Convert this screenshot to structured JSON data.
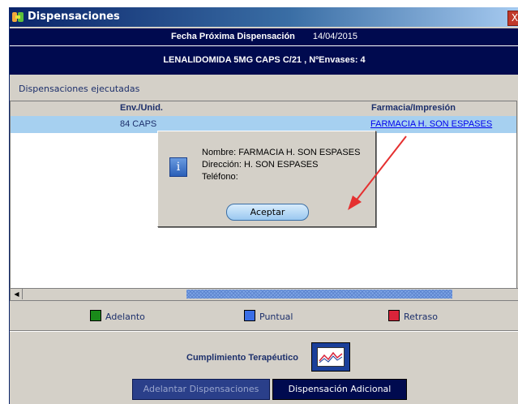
{
  "window": {
    "title": "Dispensaciones",
    "close_label": "X"
  },
  "header": {
    "fecha_label": "Fecha Próxima Dispensación",
    "fecha_value": "14/04/2015",
    "medication": "LENALIDOMIDA 5MG CAPS C/21  , NºEnvases: 4"
  },
  "section": {
    "title": "Dispensaciones ejecutadas"
  },
  "table": {
    "columns": [
      "Env./Unid.",
      "Farmacia/Impresión"
    ],
    "rows": [
      {
        "env_unid": "84 CAPS",
        "farmacia": "FARMACIA H. SON ESPASES"
      }
    ]
  },
  "legend": {
    "items": [
      {
        "label": "Adelanto",
        "color": "#1a8a1a"
      },
      {
        "label": "Puntual",
        "color": "#3a6ee6"
      },
      {
        "label": "Retraso",
        "color": "#d8243a"
      }
    ]
  },
  "cumplimiento": {
    "label": "Cumplimiento Terapéutico",
    "icon": "chart-line-icon"
  },
  "buttons": {
    "adelantar": "Adelantar Dispensaciones",
    "adicional": "Dispensación Adicional"
  },
  "dialog": {
    "nombre": "Nombre: FARMACIA H. SON ESPASES",
    "direccion": "Dirección: H. SON ESPASES",
    "telefono": "Teléfono:",
    "ok_label": "Aceptar",
    "icon": "info-icon"
  },
  "annotation": {
    "arrow_color": "#e53030"
  }
}
